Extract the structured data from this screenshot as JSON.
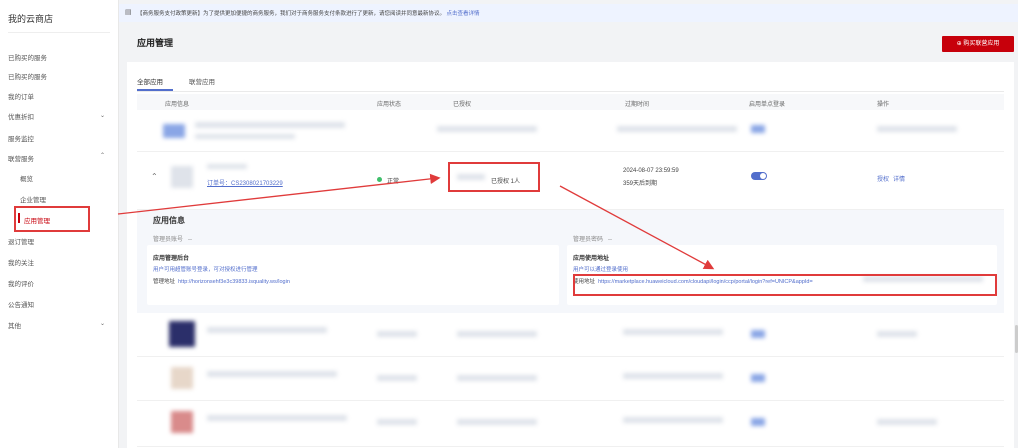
{
  "sidebar": {
    "title": "我的云商店",
    "items": [
      {
        "label": "已购买的服务"
      },
      {
        "label": "已购买的服务"
      },
      {
        "label": "我的订单"
      },
      {
        "label": "优惠折扣"
      },
      {
        "label": "服务监控"
      },
      {
        "label": "联营服务"
      },
      {
        "label": "概览"
      },
      {
        "label": "企业管理"
      },
      {
        "label": "应用管理"
      },
      {
        "label": "退订管理"
      },
      {
        "label": "我的关注"
      },
      {
        "label": "我的评价"
      },
      {
        "label": "公告通知"
      },
      {
        "label": "其他"
      }
    ]
  },
  "notice": {
    "icon": "bell-icon",
    "text": "【商务服务支付政策更新】为了提供更加便捷的商务服务，我们对于商务服务支付条款进行了更新，请您阅读并同意最新协议。",
    "link": "点击查看详情"
  },
  "page": {
    "title": "应用管理",
    "buy_button": "购买联营应用"
  },
  "tabs": [
    {
      "label": "全部应用",
      "active": true
    },
    {
      "label": "联营应用",
      "active": false
    }
  ],
  "table": {
    "headers": [
      "应用信息",
      "应用状态",
      "已授权",
      "过期时间",
      "启用单点登录",
      "操作"
    ]
  },
  "expanded_row": {
    "order_no": "订单号：CS2308021703229",
    "status": "正常",
    "authorized": "已授权 1人",
    "expire_date": "2024-08-07 23:59:59",
    "expire_note": "359天后到期",
    "actions": [
      "授权",
      "详情"
    ]
  },
  "app_info": {
    "title": "应用信息",
    "admin_account_label": "管理员账号",
    "admin_account_value": "--",
    "admin_pwd_label": "管理员密码",
    "admin_pwd_value": "--",
    "mgmt_card": {
      "title": "应用管理后台",
      "sub": "用户可用超管账号登录，可对授权进行管理",
      "addr_label": "管理地址",
      "addr": "http://horizonsehf3e3c39833.isquality.ws/login"
    },
    "user_card": {
      "title": "应用使用地址",
      "sub": "用户可以通过登录使用",
      "addr_label": "使用地址",
      "addr": "https://marketplace.huaweicloud.com/cloudapi/login/ccp/portal/login?ref=UNICP&appId="
    }
  },
  "colors": {
    "brand_red": "#c7000b",
    "link_blue": "#526ecc",
    "annotation_red": "#e03b3b"
  }
}
